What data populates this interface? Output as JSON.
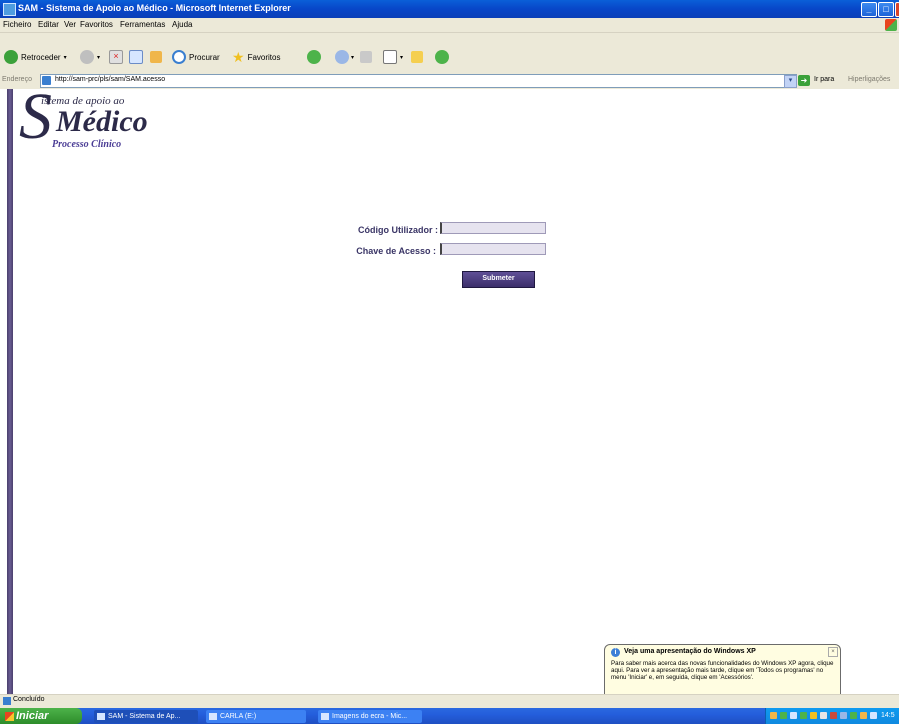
{
  "window": {
    "title": "SAM - Sistema de Apoio ao Médico - Microsoft Internet Explorer",
    "controls": [
      "_",
      "□",
      "×"
    ]
  },
  "menu": [
    "Ficheiro",
    "Editar",
    "Ver",
    "Favoritos",
    "Ferramentas",
    "Ajuda"
  ],
  "toolbar": {
    "back": "Retroceder",
    "search": "Procurar",
    "favorites": "Favoritos"
  },
  "address": {
    "label": "Endereço",
    "url": "http://sam-prc/pls/sam/SAM.acesso",
    "go": "Ir para",
    "links": "Hiperligações"
  },
  "logo": {
    "initial": "S",
    "line1": "istema de apoio ao",
    "line2": "Médico",
    "line3": "Processo Clínico"
  },
  "form": {
    "user_label": "Código Utilizador :",
    "password_label": "Chave de Acesso :",
    "user_value": "",
    "password_value": "",
    "submit": "Submeter"
  },
  "balloon": {
    "title": "Veja uma apresentação do Windows XP",
    "body": "Para saber mais acerca das novas funcionalidades do Windows XP agora, clique aqui. Para ver a apresentação mais tarde, clique em 'Todos os programas' no menu 'Iniciar' e, em seguida, clique em 'Acessórios'."
  },
  "status": {
    "text": "Concluído"
  },
  "taskbar": {
    "start": "Iniciar",
    "items": [
      "SAM - Sistema de Ap...",
      "CARLA (E:)",
      "Imagens do ecra - Mic..."
    ],
    "clock": "14:5"
  }
}
